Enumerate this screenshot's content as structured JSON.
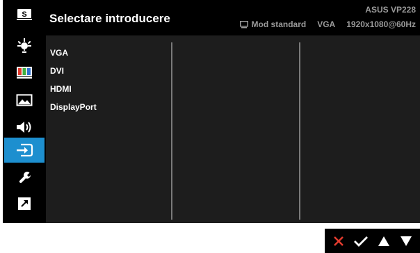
{
  "header": {
    "title": "Selectare introducere",
    "model": "ASUS  VP228",
    "mode": "Mod standard",
    "input": "VGA",
    "resolution": "1920x1080@60Hz"
  },
  "menu": {
    "items": [
      "VGA",
      "DVI",
      "HDMI",
      "DisplayPort"
    ]
  },
  "sidebar": {
    "items": [
      {
        "icon": "splendid-icon",
        "label": "S"
      },
      {
        "icon": "blue-light-icon"
      },
      {
        "icon": "color-icon"
      },
      {
        "icon": "image-icon"
      },
      {
        "icon": "sound-icon"
      },
      {
        "icon": "input-select-icon",
        "active": true
      },
      {
        "icon": "system-setup-icon"
      },
      {
        "icon": "shortcut-icon"
      }
    ]
  },
  "buttons": [
    "close-icon",
    "check-icon",
    "up-arrow-icon",
    "down-arrow-icon"
  ],
  "colors": {
    "active": "#1d8fcf",
    "close": "#e23b2e",
    "background": "#000000",
    "panel": "#1d1d1d",
    "muted_text": "#9a9a9a"
  }
}
